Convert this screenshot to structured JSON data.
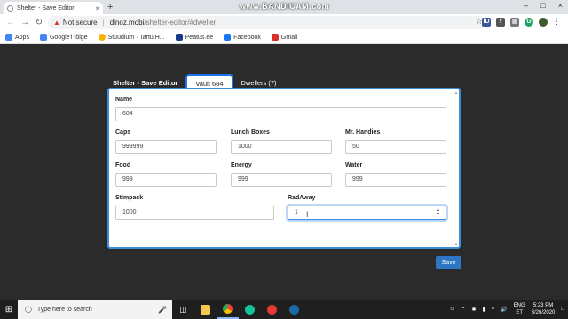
{
  "browser": {
    "tab_title": "Shelter - Save Editor",
    "tab_close": "×",
    "new_tab": "+",
    "watermark": "www.BANDICAM.com",
    "window_controls": [
      "–",
      "□",
      "×"
    ],
    "not_secure_label": "Not secure",
    "url_host": "dinoz.mobi",
    "url_path": "/shelter-editor/#dweller",
    "bookmarks": [
      {
        "label": "Apps",
        "icon": "apps-grid-icon",
        "color": "#4285f4"
      },
      {
        "label": "Google'i tõlge",
        "icon": "google-translate-icon",
        "color": "#4285f4"
      },
      {
        "label": "Stuudium · Tartu H...",
        "icon": "stuudium-icon",
        "color": "#f4b400"
      },
      {
        "label": "Peatus.ee",
        "icon": "peatus-icon",
        "color": "#1a3a8a"
      },
      {
        "label": "Facebook",
        "icon": "facebook-icon",
        "color": "#1877f2"
      },
      {
        "label": "Gmail",
        "icon": "gmail-icon",
        "color": "#d93025"
      }
    ]
  },
  "app": {
    "brand": "Shelter - Save Editor",
    "tabs": [
      {
        "label": "Vault 684",
        "active": true
      },
      {
        "label": "Dwellers (7)",
        "active": false
      }
    ],
    "fields": {
      "name": {
        "label": "Name",
        "value": "684"
      },
      "caps": {
        "label": "Caps",
        "value": "999999"
      },
      "lunchboxes": {
        "label": "Lunch Boxes",
        "value": "1000"
      },
      "mrhandies": {
        "label": "Mr. Handies",
        "value": "50"
      },
      "food": {
        "label": "Food",
        "value": "999"
      },
      "energy": {
        "label": "Energy",
        "value": "999"
      },
      "water": {
        "label": "Water",
        "value": "999"
      },
      "stimpack": {
        "label": "Stimpack",
        "value": "1000"
      },
      "radaway": {
        "label": "RadAway",
        "value": "1"
      }
    },
    "save_label": "Save",
    "accent_color": "#3c8dde"
  },
  "taskbar": {
    "search_placeholder": "Type here to search",
    "lang_top": "ENG",
    "lang_bottom": "ET",
    "time": "5:23 PM",
    "date": "3/26/2020"
  }
}
